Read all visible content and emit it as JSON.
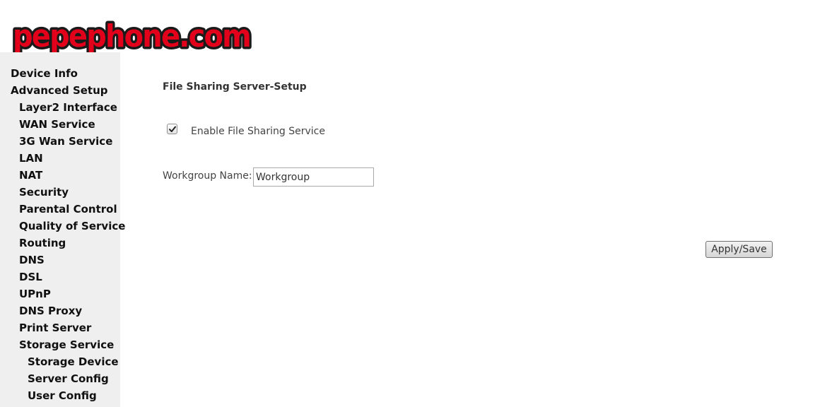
{
  "logo": {
    "alt": "pepephone.com",
    "colors": {
      "outer": "#1a1a1a",
      "fill": "#e3001b"
    }
  },
  "sidebar": {
    "items": [
      {
        "label": "Device Info",
        "level": 0
      },
      {
        "label": "Advanced Setup",
        "level": 0
      },
      {
        "label": "Layer2 Interface",
        "level": 1
      },
      {
        "label": "WAN Service",
        "level": 1
      },
      {
        "label": "3G Wan Service",
        "level": 1
      },
      {
        "label": "LAN",
        "level": 1
      },
      {
        "label": "NAT",
        "level": 1
      },
      {
        "label": "Security",
        "level": 1
      },
      {
        "label": "Parental Control",
        "level": 1
      },
      {
        "label": "Quality of Service",
        "level": 1
      },
      {
        "label": "Routing",
        "level": 1
      },
      {
        "label": "DNS",
        "level": 1
      },
      {
        "label": "DSL",
        "level": 1
      },
      {
        "label": "UPnP",
        "level": 1
      },
      {
        "label": "DNS Proxy",
        "level": 1
      },
      {
        "label": "Print Server",
        "level": 1
      },
      {
        "label": "Storage Service",
        "level": 1
      },
      {
        "label": "Storage Device",
        "level": 2
      },
      {
        "label": "Server Config",
        "level": 2
      },
      {
        "label": "User Config",
        "level": 2
      }
    ]
  },
  "main": {
    "title": "File Sharing Server-Setup",
    "enable_checkbox": {
      "label": "Enable File Sharing Service",
      "checked": true
    },
    "workgroup": {
      "label": "Workgroup Name:",
      "value": "Workgroup"
    },
    "apply_button": "Apply/Save"
  },
  "colors": {
    "sidebar_bg": "#efefef",
    "nav_text": "#101010",
    "body_text": "#444444"
  }
}
